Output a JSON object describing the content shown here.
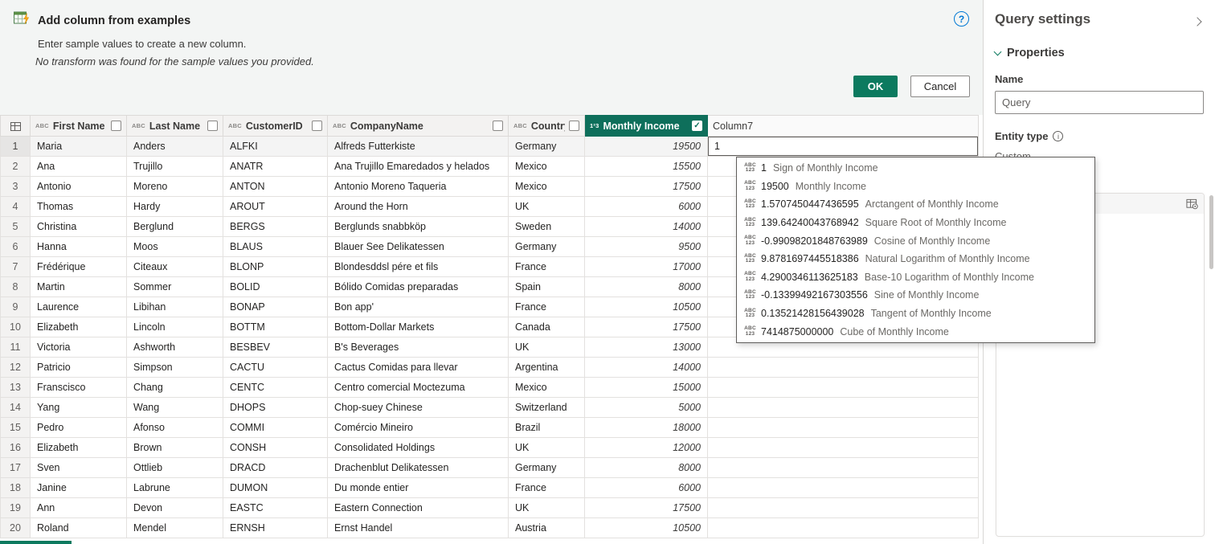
{
  "colors": {
    "accent_teal": "#0c7a5f",
    "selected_column_header": "#0e6f5b",
    "help_blue": "#0078d4"
  },
  "icons": {
    "check": "✓",
    "abc": "ABC",
    "num123": "123"
  },
  "banner": {
    "title": "Add column from examples",
    "subtitle": "Enter sample values to create a new column.",
    "note": "No transform was found for the sample values you provided.",
    "ok_label": "OK",
    "cancel_label": "Cancel",
    "help_icon": "?"
  },
  "table": {
    "columns": [
      {
        "label": "First Name",
        "type_icon": "ABC",
        "checked": false
      },
      {
        "label": "Last Name",
        "type_icon": "ABC",
        "checked": false
      },
      {
        "label": "CustomerID",
        "type_icon": "ABC",
        "checked": false
      },
      {
        "label": "CompanyName",
        "type_icon": "ABC",
        "checked": false
      },
      {
        "label": "Country",
        "type_icon": "ABC",
        "checked": false
      },
      {
        "label": "Monthly Income",
        "type_icon": "1²3",
        "checked": true,
        "selected": true
      },
      {
        "label": "Column7",
        "type_icon": "",
        "new": true
      }
    ],
    "new_column_input": "1",
    "rows": [
      [
        "1",
        "Maria",
        "Anders",
        "ALFKI",
        "Alfreds Futterkiste",
        "Germany",
        "19500"
      ],
      [
        "2",
        "Ana",
        "Trujillo",
        "ANATR",
        "Ana Trujillo Emaredados y helados",
        "Mexico",
        "15500"
      ],
      [
        "3",
        "Antonio",
        "Moreno",
        "ANTON",
        "Antonio Moreno Taqueria",
        "Mexico",
        "17500"
      ],
      [
        "4",
        "Thomas",
        "Hardy",
        "AROUT",
        "Around the Horn",
        "UK",
        "6000"
      ],
      [
        "5",
        "Christina",
        "Berglund",
        "BERGS",
        "Berglunds snabbköp",
        "Sweden",
        "14000"
      ],
      [
        "6",
        "Hanna",
        "Moos",
        "BLAUS",
        "Blauer See Delikatessen",
        "Germany",
        "9500"
      ],
      [
        "7",
        "Frédérique",
        "Citeaux",
        "BLONP",
        "Blondesddsl pére et fils",
        "France",
        "17000"
      ],
      [
        "8",
        "Martin",
        "Sommer",
        "BOLID",
        "Bólido Comidas preparadas",
        "Spain",
        "8000"
      ],
      [
        "9",
        "Laurence",
        "Libihan",
        "BONAP",
        "Bon app'",
        "France",
        "10500"
      ],
      [
        "10",
        "Elizabeth",
        "Lincoln",
        "BOTTM",
        "Bottom-Dollar Markets",
        "Canada",
        "17500"
      ],
      [
        "11",
        "Victoria",
        "Ashworth",
        "BESBEV",
        "B's Beverages",
        "UK",
        "13000"
      ],
      [
        "12",
        "Patricio",
        "Simpson",
        "CACTU",
        "Cactus Comidas para llevar",
        "Argentina",
        "14000"
      ],
      [
        "13",
        "Franscisco",
        "Chang",
        "CENTC",
        "Centro comercial Moctezuma",
        "Mexico",
        "15000"
      ],
      [
        "14",
        "Yang",
        "Wang",
        "DHOPS",
        "Chop-suey Chinese",
        "Switzerland",
        "5000"
      ],
      [
        "15",
        "Pedro",
        "Afonso",
        "COMMI",
        "Comércio Mineiro",
        "Brazil",
        "18000"
      ],
      [
        "16",
        "Elizabeth",
        "Brown",
        "CONSH",
        "Consolidated Holdings",
        "UK",
        "12000"
      ],
      [
        "17",
        "Sven",
        "Ottlieb",
        "DRACD",
        "Drachenblut Delikatessen",
        "Germany",
        "8000"
      ],
      [
        "18",
        "Janine",
        "Labrune",
        "DUMON",
        "Du monde entier",
        "France",
        "6000"
      ],
      [
        "19",
        "Ann",
        "Devon",
        "EASTC",
        "Eastern Connection",
        "UK",
        "17500"
      ],
      [
        "20",
        "Roland",
        "Mendel",
        "ERNSH",
        "Ernst Handel",
        "Austria",
        "10500"
      ]
    ]
  },
  "suggestions": {
    "items": [
      {
        "value": "1",
        "label": "Sign of Monthly Income"
      },
      {
        "value": "19500",
        "label": "Monthly Income"
      },
      {
        "value": "1.5707450447436595",
        "label": "Arctangent of Monthly Income"
      },
      {
        "value": "139.64240043768942",
        "label": "Square Root of Monthly Income"
      },
      {
        "value": "-0.99098201848763989",
        "label": "Cosine of Monthly Income"
      },
      {
        "value": "9.8781697445518386",
        "label": "Natural Logarithm of Monthly Income"
      },
      {
        "value": "4.2900346113625183",
        "label": "Base-10 Logarithm of Monthly Income"
      },
      {
        "value": "-0.13399492167303556",
        "label": "Sine of Monthly Income"
      },
      {
        "value": "0.13521428156439028",
        "label": "Tangent of Monthly Income"
      },
      {
        "value": "7414875000000",
        "label": "Cube of Monthly Income"
      }
    ]
  },
  "sidebar": {
    "title": "Query settings",
    "properties_label": "Properties",
    "name_label": "Name",
    "name_value": "Query",
    "entity_type_label": "Entity type",
    "entity_type_value": "Custom",
    "info_icon": "i"
  }
}
